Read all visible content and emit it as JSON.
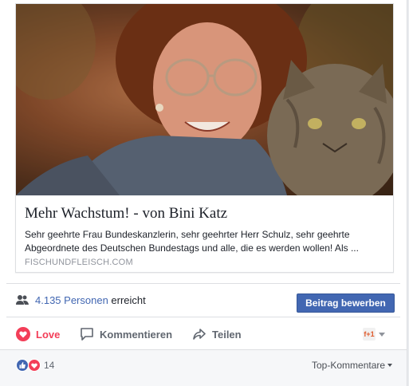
{
  "link_preview": {
    "title": "Mehr Wachstum! - von Bini Katz",
    "description": "Sehr geehrte Frau Bundeskanzlerin, sehr geehrter Herr Schulz, sehr geehrte Abgeordnete des Deutschen Bundestags und alle, die es werden wollen! Als ...",
    "domain": "FISCHUNDFLEISCH.COM",
    "image_icon": "photo-woman-with-cat"
  },
  "reach": {
    "count": "4.135 Personen",
    "suffix": "erreicht",
    "icon": "people-icon",
    "boost_label": "Beitrag bewerben"
  },
  "actions": {
    "love_label": "Love",
    "comment_label": "Kommentieren",
    "share_label": "Teilen",
    "avatar_selector_text": "f+1"
  },
  "reactions": {
    "count": "14",
    "sort_label": "Top-Kommentare"
  },
  "colors": {
    "facebook_blue": "#4267b2",
    "love_red": "#f33e58",
    "gray_text": "#616770"
  }
}
